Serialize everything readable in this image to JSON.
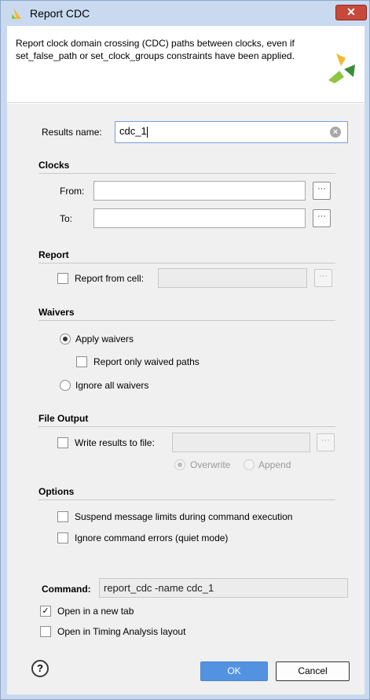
{
  "window": {
    "title": "Report CDC",
    "close_glyph": "✕",
    "description": "Report clock domain crossing (CDC) paths between clocks, even if set_false_path or set_clock_groups constraints have been applied."
  },
  "results": {
    "label": "Results name:",
    "value": "cdc_1"
  },
  "clocks": {
    "section": "Clocks",
    "from_label": "From:",
    "to_label": "To:",
    "browse_glyph": "···"
  },
  "report": {
    "section": "Report",
    "from_cell_label": "Report from cell:"
  },
  "waivers": {
    "section": "Waivers",
    "apply_label": "Apply waivers",
    "report_only_label": "Report only waived paths",
    "ignore_label": "Ignore all waivers"
  },
  "file_output": {
    "section": "File Output",
    "write_label": "Write results to file:",
    "overwrite_label": "Overwrite",
    "append_label": "Append"
  },
  "options": {
    "section": "Options",
    "suspend_label": "Suspend message limits during command execution",
    "ignore_errors_label": "Ignore command errors (quiet mode)"
  },
  "command": {
    "label": "Command:",
    "value": "report_cdc -name cdc_1"
  },
  "open_new_tab_label": "Open in a new tab",
  "open_timing_label": "Open in Timing Analysis layout",
  "check_glyph": "✓",
  "buttons": {
    "help": "?",
    "ok": "OK",
    "cancel": "Cancel"
  },
  "colors": {
    "ok_button": "#5292e0",
    "title_bar": "#c9daf0",
    "close_button": "#c7493b"
  }
}
